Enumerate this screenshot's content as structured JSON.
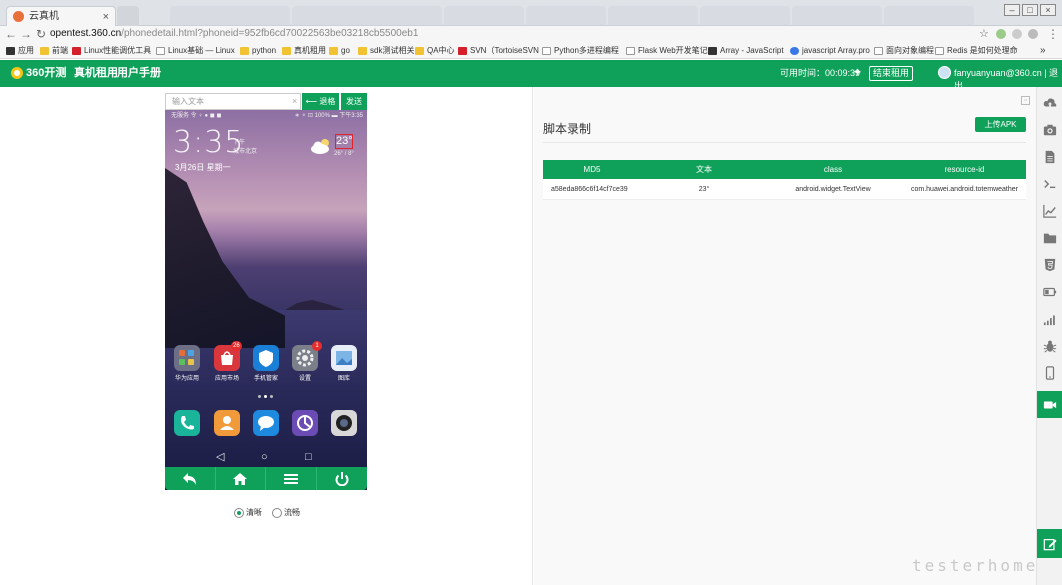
{
  "browser": {
    "tabs": [
      {
        "label": "云真机",
        "active": true
      },
      {
        "label": "",
        "active": false
      }
    ],
    "url_host": "opentest.360.cn",
    "url_path": "/phonedetail.html?phoneid=952fb6cd70022563be03218cb5500eb1",
    "bookmarks": [
      "应用",
      "前端",
      "Linux性能调优工具",
      "Linux基础 — Linux",
      "python",
      "真机租用",
      "go",
      "sdk测试相关",
      "QA中心",
      "SVN（TortoiseSVN",
      "Python多进程编程",
      "Flask Web开发笔记",
      "Array - JavaScript",
      "javascript Array.pro",
      "面向对象编程",
      "Redis 是如何处理命"
    ],
    "bookmarks_more": "»"
  },
  "header": {
    "logo": "360开测",
    "nav": [
      "真机租用",
      "用户手册"
    ],
    "timer_label": "可用时间：00:09:39",
    "plus": "+",
    "end_rent": "结束租用",
    "email": "fanyuanyuan@360.cn",
    "logout": "| 退出"
  },
  "input": {
    "placeholder": "输入文本",
    "clear": "×",
    "backspace": "⟵ 退格",
    "send": "发送"
  },
  "phone": {
    "status_left": "无服务 令 ♀ ● ◼ ◼",
    "status_right": "∗ ⚬ ⊡ 100% ▬ 下午3:35",
    "time": "3:35",
    "ampm": "下午",
    "city": "城市北京",
    "date": "3月26日 星期一",
    "temp": "23°",
    "temp_range": "26° / 8°",
    "apps": [
      {
        "label": "华为应用",
        "badge": ""
      },
      {
        "label": "应用市场",
        "badge": "26"
      },
      {
        "label": "手机管家",
        "badge": ""
      },
      {
        "label": "设置",
        "badge": "1"
      },
      {
        "label": "图库",
        "badge": ""
      }
    ],
    "softkeys": [
      "◁",
      "○",
      "□"
    ]
  },
  "quality": {
    "hd": "清晰",
    "smooth": "流畅",
    "selected": "hd"
  },
  "script": {
    "title": "脚本录制",
    "upload_apk": "上传APK",
    "columns": [
      "MD5",
      "文本",
      "class",
      "resource-id"
    ],
    "rows": [
      [
        "a58eda866c6f14cf7ce39",
        "23°",
        "android.widget.TextView",
        "com.huawei.android.totemweather"
      ]
    ]
  },
  "rail_icons": [
    "upload-cloud-icon",
    "camera-icon",
    "document-icon",
    "terminal-icon",
    "chart-line-icon",
    "folder-icon",
    "html5-icon",
    "battery-icon",
    "signal-icon",
    "bug-icon",
    "phone-icon",
    "video-icon",
    "edit-icon"
  ],
  "colors": {
    "brand": "#0fa15a",
    "highlight": "#e0242a"
  },
  "watermark": "testerhome"
}
